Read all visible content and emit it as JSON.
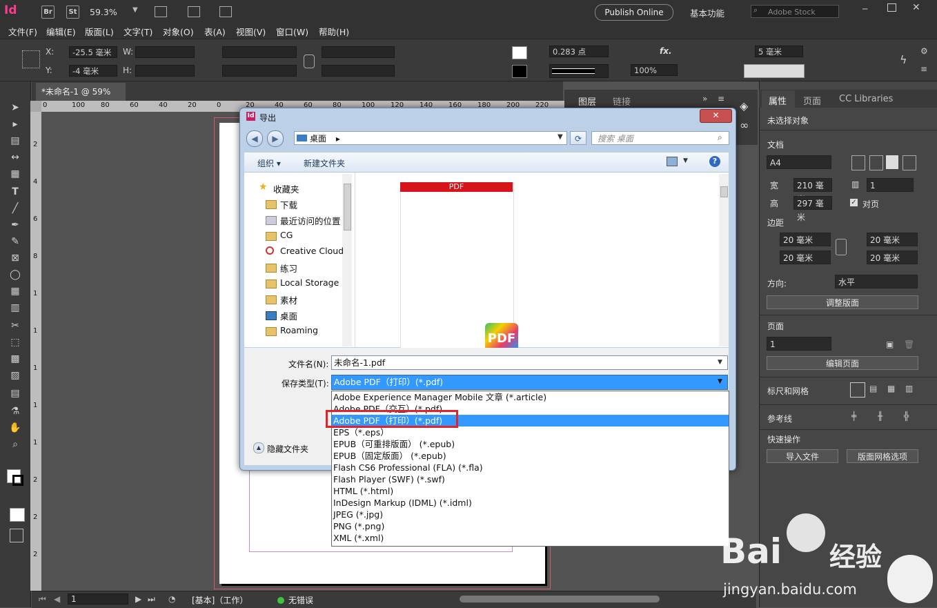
{
  "app": {
    "logo": "Id",
    "bridge": "Br",
    "stock_app": "St",
    "zoom": "59.3%",
    "publish_online": "Publish Online",
    "workspace": "基本功能",
    "search_placeholder": "Adobe Stock"
  },
  "menu": [
    "文件(F)",
    "编辑(E)",
    "版面(L)",
    "文字(T)",
    "对象(O)",
    "表(A)",
    "视图(V)",
    "窗口(W)",
    "帮助(H)"
  ],
  "control": {
    "x_label": "X:",
    "x_value": "-25.5 毫米",
    "y_label": "Y:",
    "y_value": "-4 毫米",
    "w_label": "W:",
    "h_label": "H:",
    "stroke_weight": "0.283 点",
    "opacity": "100%",
    "fx": "fx.",
    "spacing": "5 毫米"
  },
  "document_tab": "*未命名-1 @ 59%",
  "ruler_h": [
    "0",
    "100",
    "80",
    "60",
    "40",
    "20",
    "0",
    "20",
    "40",
    "60",
    "80",
    "100",
    "120",
    "140",
    "160",
    "180",
    "200",
    "220"
  ],
  "ruler_v": [
    "0",
    "2",
    "4",
    "6",
    "8",
    "1",
    "1",
    "1",
    "1",
    "1",
    "2",
    "2",
    "2"
  ],
  "layers_panel": {
    "layers": "图层",
    "links": "链接"
  },
  "properties": {
    "tabs": [
      "属性",
      "页面",
      "CC Libraries"
    ],
    "no_selection": "未选择对象",
    "document": "文档",
    "page_size": "A4",
    "width_label": "宽",
    "width": "210 毫米",
    "height_label": "高",
    "height": "297 毫米",
    "pages": "1",
    "facing_pages": "对页",
    "margins": "边距",
    "margin_top": "20 毫米",
    "margin_bottom": "20 毫米",
    "margin_left": "20 毫米",
    "margin_right": "20 毫米",
    "orientation_label": "方向:",
    "orientation": "水平",
    "adjust_layout": "调整版面",
    "page_section": "页面",
    "page_number": "1",
    "edit_page": "编辑页面",
    "rulers_grids": "标尺和网格",
    "guides": "参考线",
    "quick_actions": "快速操作",
    "import_file": "导入文件",
    "layout_grid": "版面网格选项"
  },
  "status": {
    "page": "1",
    "master": "[基本]（工作）",
    "errors": "无错误"
  },
  "dialog": {
    "title": "导出",
    "close": "✕",
    "address": "桌面",
    "search_placeholder": "搜索 桌面",
    "organize": "组织 ▾",
    "new_folder": "新建文件夹",
    "nav": [
      "收藏夹",
      "下载",
      "最近访问的位置",
      "CG",
      "Creative Cloud",
      "练习",
      "Local Storage",
      "素材",
      "桌面",
      "Roaming"
    ],
    "pdf_thumb_label": "PDF",
    "pdf_icon_label": "PDF",
    "filename_label": "文件名(N):",
    "filename": "未命名-1.pdf",
    "filetype_label": "保存类型(T):",
    "filetype": "Adobe PDF（打印）(*.pdf)",
    "hide_folders": "隐藏文件夹",
    "options": [
      "Adobe Experience Manager Mobile 文章 (*.article)",
      "Adobe PDF（交互）(*.pdf)",
      "Adobe PDF（打印）(*.pdf)",
      "EPS（*.eps）",
      "EPUB（可重排版面） (*.epub)",
      "EPUB（固定版面） (*.epub)",
      "Flash CS6 Professional (FLA) (*.fla)",
      "Flash Player (SWF) (*.swf)",
      "HTML (*.html)",
      "InDesign Markup (IDML) (*.idml)",
      "JPEG (*.jpg)",
      "PNG (*.png)",
      "XML (*.xml)"
    ],
    "selected_index": 2
  },
  "watermark": {
    "brand": "Bai",
    "brand2": "经验",
    "url": "jingyan.baidu.com"
  },
  "colors": {
    "accent": "#3399ff",
    "highlight": "#e0242a",
    "indesign": "#ff3b8d"
  }
}
